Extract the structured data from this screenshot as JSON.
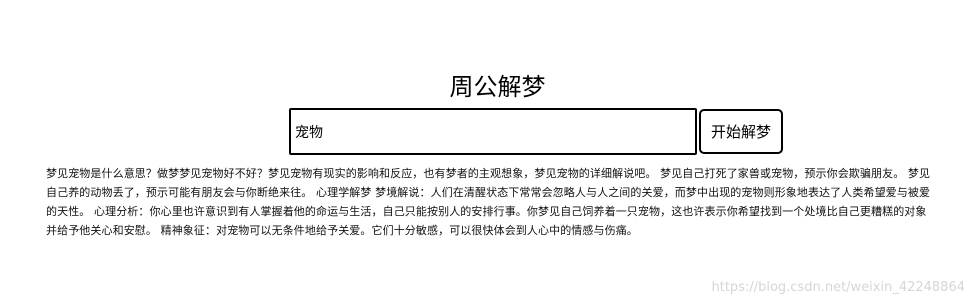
{
  "header": {
    "title": "周公解梦"
  },
  "search": {
    "value": "宠物",
    "button_label": "开始解梦"
  },
  "result": {
    "text": "梦见宠物是什么意思？做梦梦见宠物好不好？梦见宠物有现实的影响和反应，也有梦者的主观想象，梦见宠物的详细解说吧。 梦见自己打死了家兽或宠物，预示你会欺骗朋友。 梦见自己养的动物丢了，预示可能有朋友会与你断绝来往。 心理学解梦 梦境解说：人们在清醒状态下常常会忽略人与人之间的关爱，而梦中出现的宠物则形象地表达了人类希望爱与被爱的天性。 心理分析：你心里也许意识到有人掌握着他的命运与生活，自己只能按别人的安排行事。你梦见自己饲养着一只宠物，这也许表示你希望找到一个处境比自己更糟糕的对象并给予他关心和安慰。 精神象征：对宠物可以无条件地给予关爱。它们十分敏感，可以很快体会到人心中的情感与伤痛。"
  },
  "watermark": {
    "text": "https://blog.csdn.net/weixin_42248864"
  }
}
